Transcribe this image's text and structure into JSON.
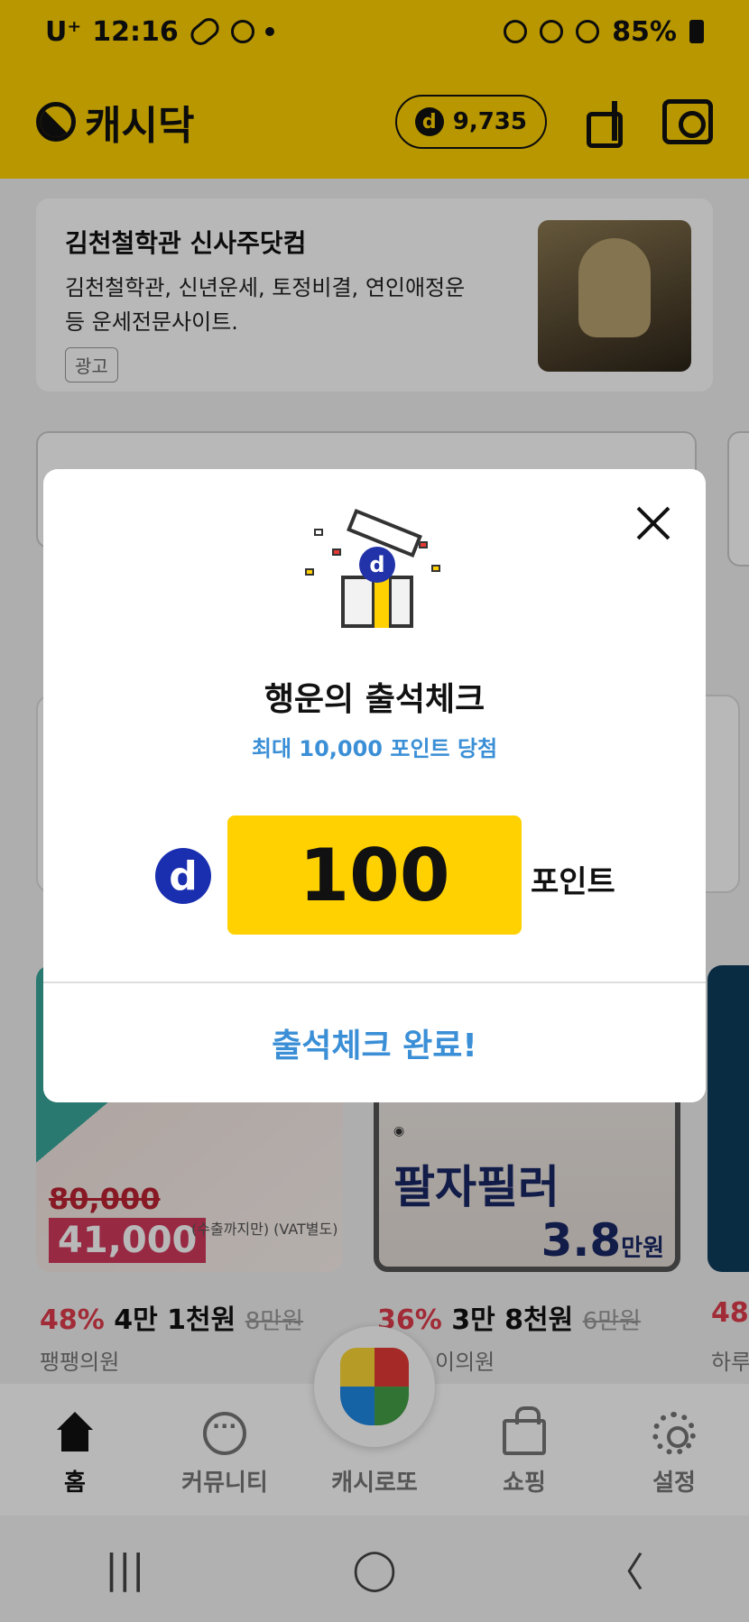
{
  "status_bar": {
    "carrier": "U⁺",
    "time": "12:16",
    "battery": "85%"
  },
  "header": {
    "app_name": "캐시닥",
    "points": "9,735",
    "point_icon": "d-coin-icon"
  },
  "ad": {
    "title": "김천철학관 신사주닷컴",
    "description": "김천철학관, 신년운세, 토정비결, 연인애정운 등 운세전문사이트.",
    "tag": "광고"
  },
  "products": [
    {
      "strike_price_image": "80,000",
      "price_image": "41,000",
      "note": "(수출까지만) (VAT별도)",
      "discount": "48%",
      "price": "4만 1천원",
      "old_price": "8만원",
      "shop": "팽팽의원"
    },
    {
      "title_image": "팔자필러",
      "price_image": "3.8",
      "price_unit": "만원",
      "discount": "36%",
      "price": "3만 8천원",
      "old_price": "6만원",
      "shop": "이의원"
    },
    {
      "discount": "48",
      "shop": "하루"
    }
  ],
  "bottom_nav": {
    "items": [
      {
        "label": "홈",
        "icon": "home-icon",
        "active": true
      },
      {
        "label": "커뮤니티",
        "icon": "chat-icon",
        "active": false
      },
      {
        "label": "캐시로또",
        "icon": "lotto-bag-icon",
        "active": false
      },
      {
        "label": "쇼핑",
        "icon": "shopping-bag-icon",
        "active": false
      },
      {
        "label": "설정",
        "icon": "gear-icon",
        "active": false
      }
    ]
  },
  "modal": {
    "title": "행운의 출석체크",
    "subtitle": "최대 10,000 포인트 당첨",
    "amount": "100",
    "unit": "포인트",
    "complete_label": "출석체크 완료!",
    "accent_color": "#3b8fd6",
    "highlight_color": "#ffd100"
  },
  "system_nav": {
    "recent": "|||",
    "home": "◯",
    "back": "〈"
  }
}
